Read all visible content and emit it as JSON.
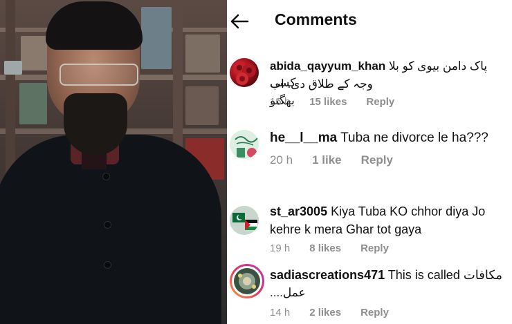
{
  "header": {
    "title": "Comments"
  },
  "comments": [
    {
      "username": "abida_qayyum_khan",
      "text_line1": "پاک دامن بیوی کو بلا کسی",
      "text_line2": "وجہ کے طلاق دی. اب بھگتو",
      "time": "16 h",
      "likes": "15 likes",
      "reply": "Reply",
      "avatar": "red-roses-avatar"
    },
    {
      "username": "he__l__ma",
      "text": "Tuba ne divorce le ha???",
      "time": "20 h",
      "likes": "1 like",
      "reply": "Reply",
      "avatar": "green-calligraphy-avatar"
    },
    {
      "username": "st_ar3005",
      "text_line1": "Kiya Tuba KO chhor diya Jo",
      "text_line2": "kehre k mera Ghar tot gaya",
      "time": "19 h",
      "likes": "8 likes",
      "reply": "Reply",
      "avatar": "flags-avatar"
    },
    {
      "username": "sadiascreations471",
      "text_latin": "This is called",
      "text_urdu1": "مکافات",
      "text_urdu2": "عمل....",
      "time": "14 h",
      "likes": "2 likes",
      "reply": "Reply",
      "avatar": "craft-avatar-with-story-ring"
    }
  ]
}
